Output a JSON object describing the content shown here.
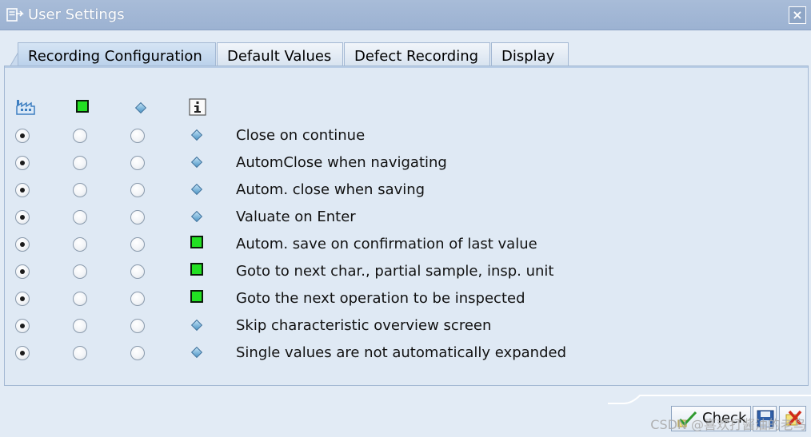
{
  "window": {
    "title": "User Settings",
    "close_glyph": "×"
  },
  "tabs": [
    {
      "label": "Recording Configuration",
      "active": true
    },
    {
      "label": "Default Values",
      "active": false
    },
    {
      "label": "Defect Recording",
      "active": false
    },
    {
      "label": "Display",
      "active": false
    }
  ],
  "column_icons": [
    "factory-icon",
    "green-square-icon",
    "diamond-icon",
    "info-icon"
  ],
  "rows": [
    {
      "label": "Close on continue",
      "selected_col": 0,
      "indicator": "diamond"
    },
    {
      "label": "AutomClose when navigating",
      "selected_col": 0,
      "indicator": "diamond"
    },
    {
      "label": "Autom. close when saving",
      "selected_col": 0,
      "indicator": "diamond"
    },
    {
      "label": "Valuate on Enter",
      "selected_col": 0,
      "indicator": "diamond"
    },
    {
      "label": "Autom. save on confirmation of last value",
      "selected_col": 0,
      "indicator": "green"
    },
    {
      "label": "Goto to next char., partial sample, insp. unit",
      "selected_col": 0,
      "indicator": "green"
    },
    {
      "label": "Goto the next operation to be inspected",
      "selected_col": 0,
      "indicator": "green"
    },
    {
      "label": "Skip characteristic overview screen",
      "selected_col": 0,
      "indicator": "diamond"
    },
    {
      "label": "Single values are not automatically expanded",
      "selected_col": 0,
      "indicator": "diamond"
    }
  ],
  "footer": {
    "check_label": "Check",
    "save_icon": "save-icon",
    "cancel_icon": "cancel-icon"
  },
  "watermark": "CSDN @喜欢打酱油的老鸟",
  "colors": {
    "titlebar": "#a8bcd8",
    "green_indicator": "#22e022",
    "diamond": "#4f97c7"
  }
}
